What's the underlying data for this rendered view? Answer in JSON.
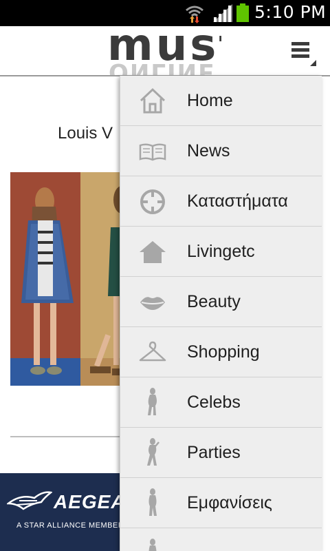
{
  "status_bar": {
    "time": "5:10 PM"
  },
  "header": {
    "logo_text": "must",
    "logo_reflection": "ONLINE",
    "menu_icon": "hamburger-menu-icon"
  },
  "article": {
    "title": "Louis V"
  },
  "ad": {
    "brand": "AEGEAN",
    "tagline": "A STAR ALLIANCE MEMBER"
  },
  "drawer": {
    "items": [
      {
        "label": "Home",
        "icon": "home-icon"
      },
      {
        "label": "News",
        "icon": "book-icon"
      },
      {
        "label": "Καταστήματα",
        "icon": "crosshair-icon"
      },
      {
        "label": "Livingetc",
        "icon": "house-icon"
      },
      {
        "label": "Beauty",
        "icon": "lips-icon"
      },
      {
        "label": "Shopping",
        "icon": "hanger-icon"
      },
      {
        "label": "Celebs",
        "icon": "woman-silhouette-icon"
      },
      {
        "label": "Parties",
        "icon": "woman-silhouette-icon"
      },
      {
        "label": "Εμφανίσεις",
        "icon": "woman-silhouette-icon"
      }
    ]
  },
  "colors": {
    "drawer_bg": "#eeeeee",
    "icon_gray": "#a7a7a7",
    "status_bar": "#000000",
    "battery_green": "#5fc400"
  }
}
